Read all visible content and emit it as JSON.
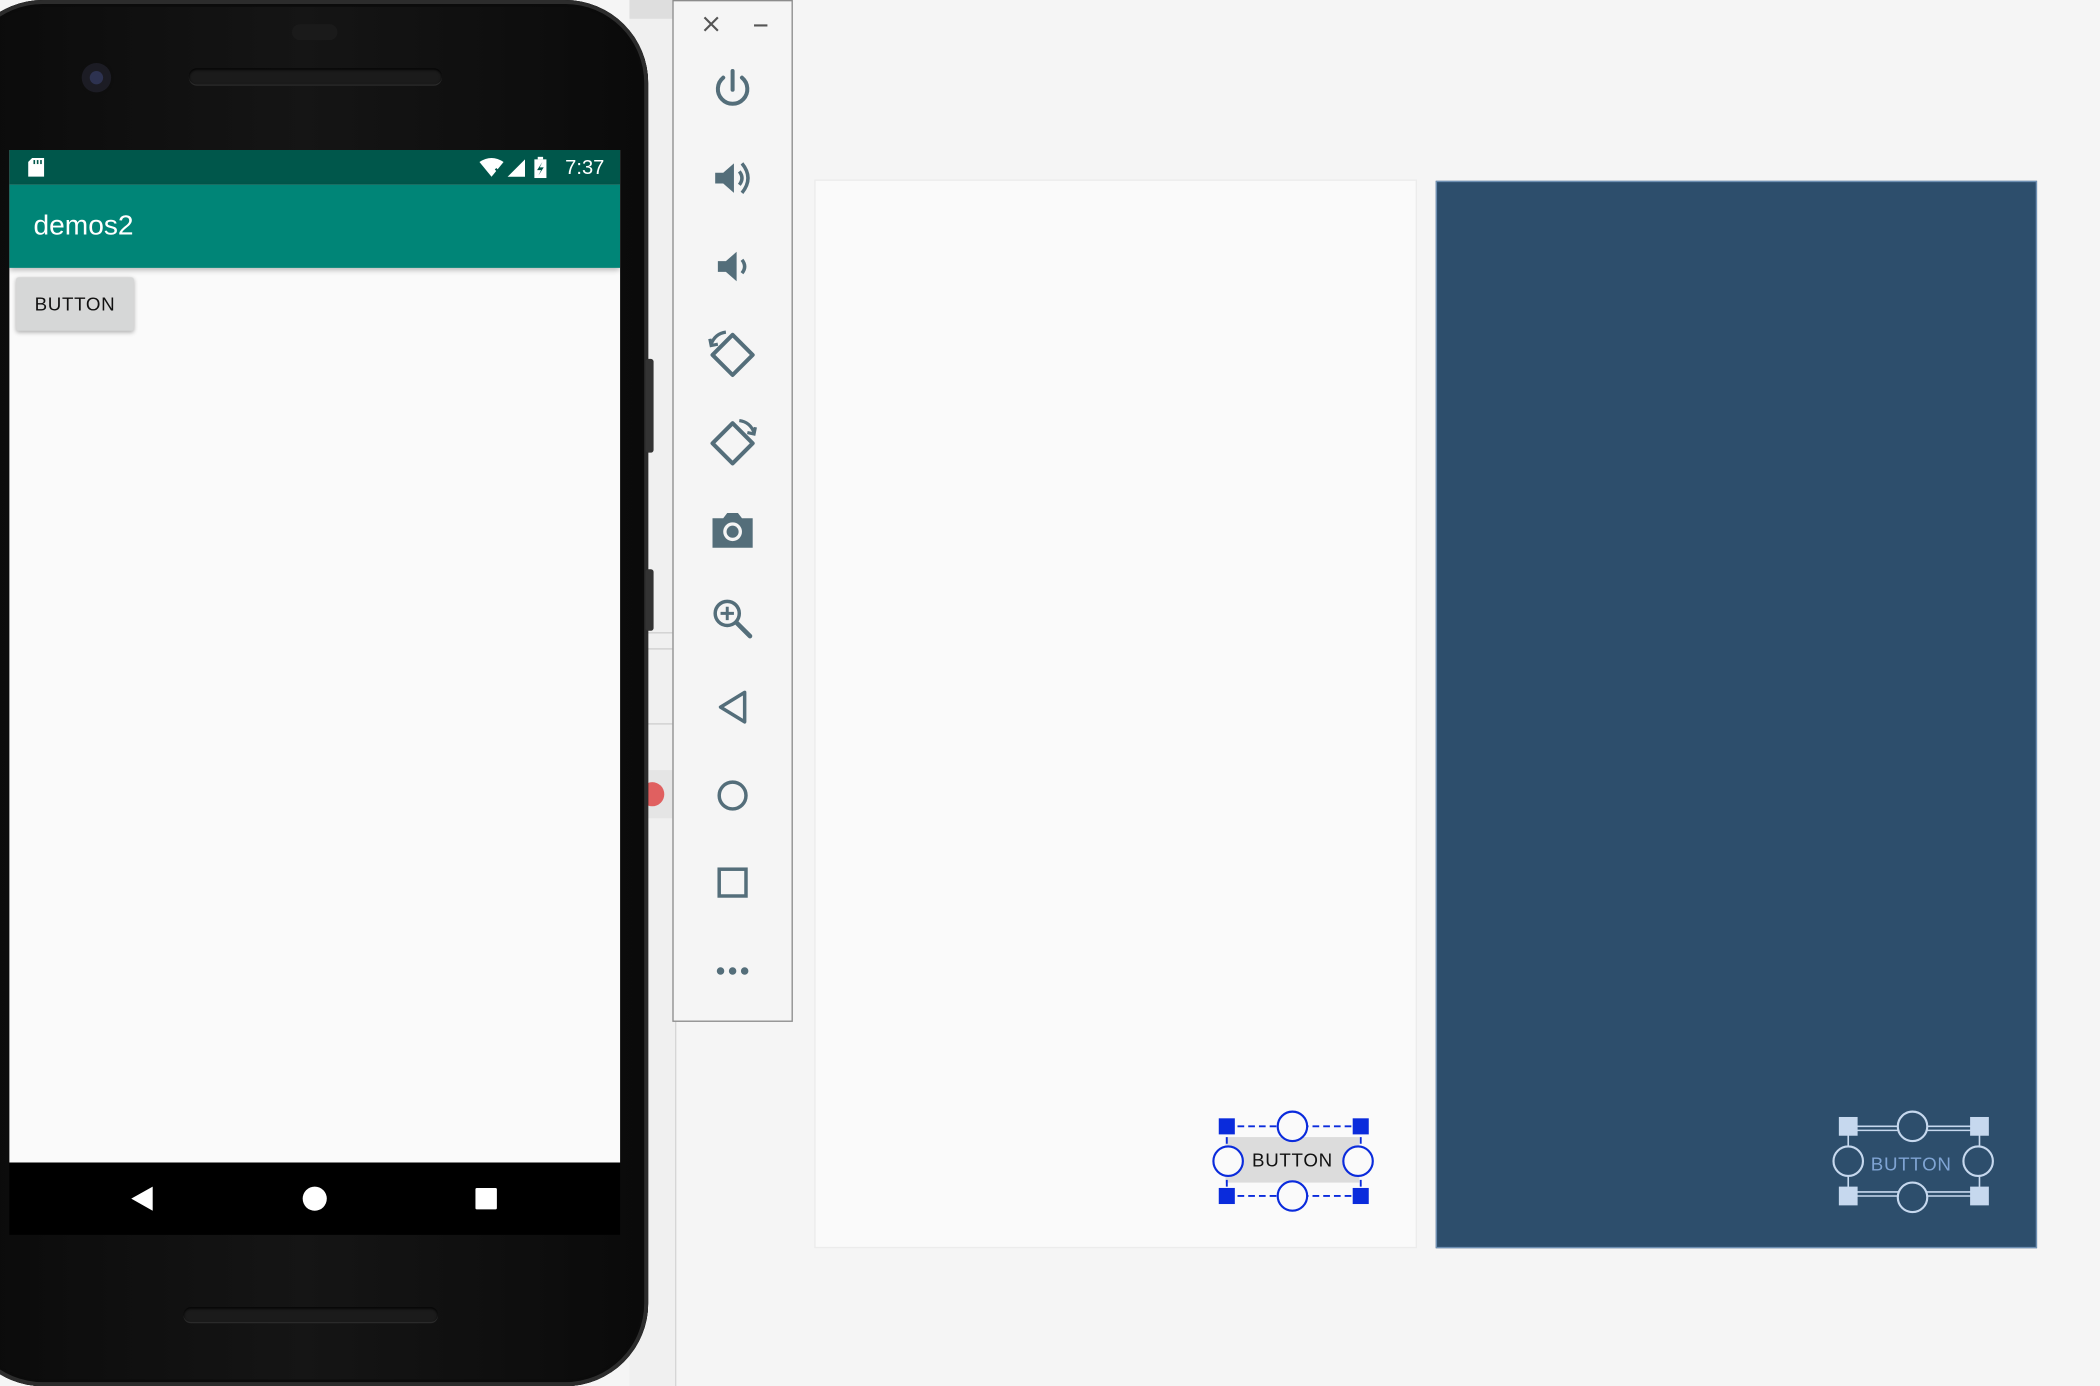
{
  "phone": {
    "status_bar": {
      "time": "7:37",
      "icons": [
        "sd-card-icon",
        "wifi-icon",
        "signal-icon",
        "battery-charging-icon"
      ]
    },
    "app_bar": {
      "title": "demos2"
    },
    "content": {
      "button_label": "BUTTON"
    },
    "nav_bar": {
      "icons": [
        "back-triangle-icon",
        "home-circle-icon",
        "recents-square-icon"
      ]
    }
  },
  "emulator_toolbar": {
    "window_controls": [
      "close-icon",
      "minimize-icon"
    ],
    "buttons": [
      "power-icon",
      "volume-up-icon",
      "volume-down-icon",
      "rotate-left-icon",
      "rotate-right-icon",
      "camera-icon",
      "zoom-in-icon",
      "back-icon",
      "home-icon",
      "overview-icon",
      "more-icon"
    ]
  },
  "layout_editor": {
    "design_view": {
      "button_label": "BUTTON"
    },
    "blueprint_view": {
      "button_label": "BUTTON"
    }
  },
  "colors": {
    "status_bar": "#00574b",
    "app_bar": "#008577",
    "blueprint_bg": "#2d4e6c",
    "selection_blue": "#0a2bdc",
    "toolbar_icon": "#546e7a"
  }
}
